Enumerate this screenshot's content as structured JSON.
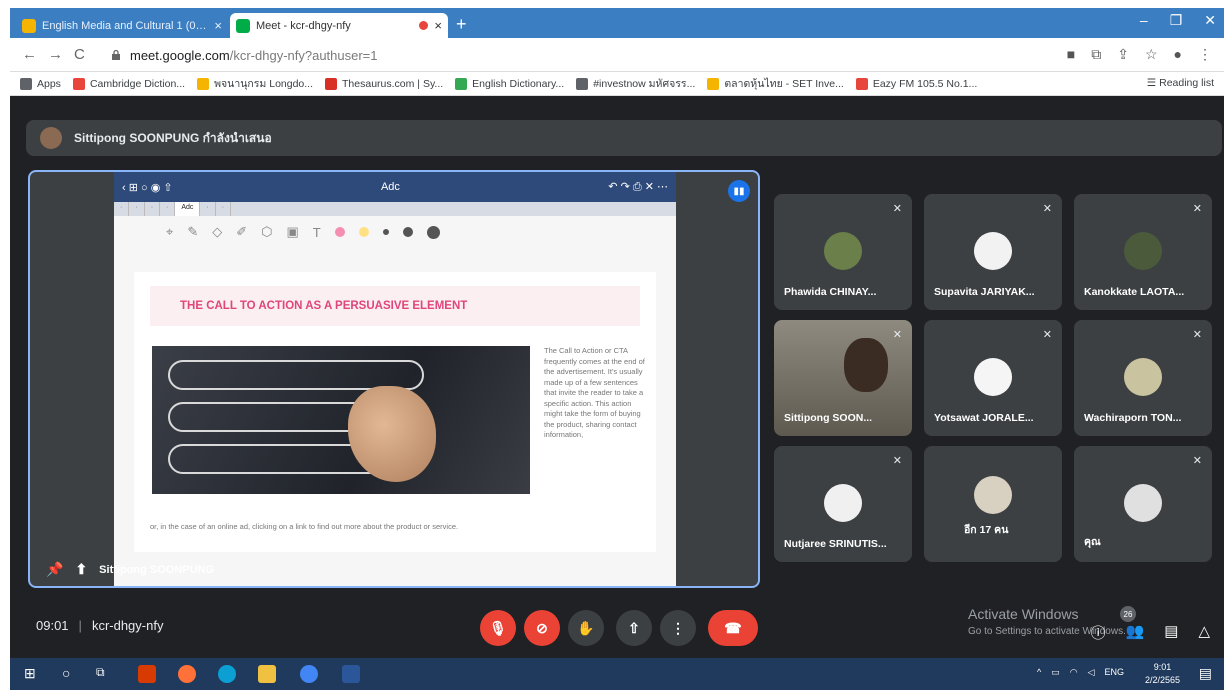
{
  "browser": {
    "tabs": [
      {
        "title": "English Media and Cultural 1 (03...",
        "color": "#f4b400"
      },
      {
        "title": "Meet - kcr-dhgy-nfy",
        "color": "#00ac47"
      }
    ],
    "url_host": "meet.google.com",
    "url_path": "/kcr-dhgy-nfy?authuser=1",
    "bookmarks": [
      {
        "label": "Apps",
        "color": "#5f6368"
      },
      {
        "label": "Cambridge Diction...",
        "color": "#e8453c"
      },
      {
        "label": "พจนานุกรม Longdo...",
        "color": "#f4b400"
      },
      {
        "label": "Thesaurus.com | Sy...",
        "color": "#d93025"
      },
      {
        "label": "English Dictionary...",
        "color": "#34a853"
      },
      {
        "label": "#investnow มหัศจรร...",
        "color": "#5f6368"
      },
      {
        "label": "ตลาดหุ้นไทย - SET Inve...",
        "color": "#f4b400"
      },
      {
        "label": "Eazy FM 105.5 No.1...",
        "color": "#e8453c"
      }
    ],
    "reading_list": "Reading list"
  },
  "meet": {
    "presenter_banner": "Sittipong SOONPUNG กำลังนำเสนอ",
    "stage_label": "Sittipong SOONPUNG",
    "slide": {
      "app_title": "Adc",
      "title": "THE CALL TO ACTION AS A PERSUASIVE ELEMENT",
      "body": "The Call to Action or CTA frequently comes at the end of the advertisement. It's usually made up of a few sentences that invite the reader to take a specific action. This action might take the form of buying the product, sharing contact information,",
      "footer": "or, in the case of an online ad, clicking on a link to find out more about the product or service."
    },
    "participants": [
      {
        "name": "Phawida CHINAY...",
        "color": "#6a7f4a"
      },
      {
        "name": "Supavita JARIYAK...",
        "color": "#f2f2f2"
      },
      {
        "name": "Kanokkate LAOTA...",
        "color": "#4a5a3a"
      },
      {
        "name": "Sittipong SOON...",
        "color": "#3a2c22"
      },
      {
        "name": "Yotsawat JORALE...",
        "color": "#f5f5f5"
      },
      {
        "name": "Wachiraporn TON...",
        "color": "#c9c3a0"
      },
      {
        "name": "Nutjaree SRINUTIS...",
        "color": "#f0f0f0"
      },
      {
        "name": "อีก 17 คน",
        "color": "#d8d0c0"
      },
      {
        "name": "คุณ",
        "color": "#e0e0e0"
      }
    ],
    "time": "09:01",
    "meeting_code": "kcr-dhgy-nfy",
    "participant_count": "26",
    "activate_title": "Activate Windows",
    "activate_sub": "Go to Settings to activate Windows."
  },
  "taskbar": {
    "lang": "ENG",
    "time": "9:01",
    "date": "2/2/2565"
  }
}
